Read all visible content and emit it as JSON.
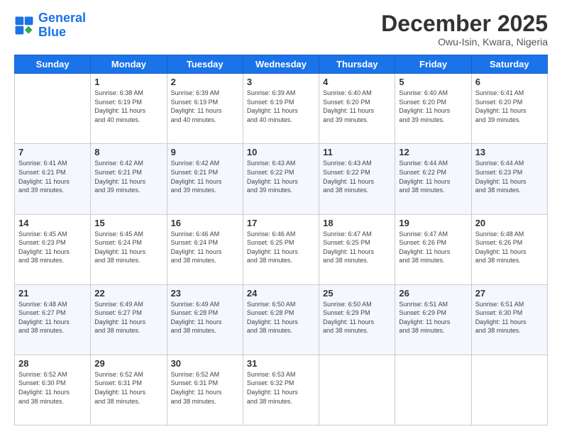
{
  "logo": {
    "line1": "General",
    "line2": "Blue"
  },
  "header": {
    "month": "December 2025",
    "location": "Owu-Isin, Kwara, Nigeria"
  },
  "weekdays": [
    "Sunday",
    "Monday",
    "Tuesday",
    "Wednesday",
    "Thursday",
    "Friday",
    "Saturday"
  ],
  "weeks": [
    [
      {
        "day": "",
        "sunrise": "",
        "sunset": "",
        "daylight": ""
      },
      {
        "day": "1",
        "sunrise": "6:38 AM",
        "sunset": "6:19 PM",
        "daylight": "11 hours and 40 minutes."
      },
      {
        "day": "2",
        "sunrise": "6:39 AM",
        "sunset": "6:19 PM",
        "daylight": "11 hours and 40 minutes."
      },
      {
        "day": "3",
        "sunrise": "6:39 AM",
        "sunset": "6:19 PM",
        "daylight": "11 hours and 40 minutes."
      },
      {
        "day": "4",
        "sunrise": "6:40 AM",
        "sunset": "6:20 PM",
        "daylight": "11 hours and 39 minutes."
      },
      {
        "day": "5",
        "sunrise": "6:40 AM",
        "sunset": "6:20 PM",
        "daylight": "11 hours and 39 minutes."
      },
      {
        "day": "6",
        "sunrise": "6:41 AM",
        "sunset": "6:20 PM",
        "daylight": "11 hours and 39 minutes."
      }
    ],
    [
      {
        "day": "7",
        "sunrise": "6:41 AM",
        "sunset": "6:21 PM",
        "daylight": "11 hours and 39 minutes."
      },
      {
        "day": "8",
        "sunrise": "6:42 AM",
        "sunset": "6:21 PM",
        "daylight": "11 hours and 39 minutes."
      },
      {
        "day": "9",
        "sunrise": "6:42 AM",
        "sunset": "6:21 PM",
        "daylight": "11 hours and 39 minutes."
      },
      {
        "day": "10",
        "sunrise": "6:43 AM",
        "sunset": "6:22 PM",
        "daylight": "11 hours and 39 minutes."
      },
      {
        "day": "11",
        "sunrise": "6:43 AM",
        "sunset": "6:22 PM",
        "daylight": "11 hours and 38 minutes."
      },
      {
        "day": "12",
        "sunrise": "6:44 AM",
        "sunset": "6:22 PM",
        "daylight": "11 hours and 38 minutes."
      },
      {
        "day": "13",
        "sunrise": "6:44 AM",
        "sunset": "6:23 PM",
        "daylight": "11 hours and 38 minutes."
      }
    ],
    [
      {
        "day": "14",
        "sunrise": "6:45 AM",
        "sunset": "6:23 PM",
        "daylight": "11 hours and 38 minutes."
      },
      {
        "day": "15",
        "sunrise": "6:45 AM",
        "sunset": "6:24 PM",
        "daylight": "11 hours and 38 minutes."
      },
      {
        "day": "16",
        "sunrise": "6:46 AM",
        "sunset": "6:24 PM",
        "daylight": "11 hours and 38 minutes."
      },
      {
        "day": "17",
        "sunrise": "6:46 AM",
        "sunset": "6:25 PM",
        "daylight": "11 hours and 38 minutes."
      },
      {
        "day": "18",
        "sunrise": "6:47 AM",
        "sunset": "6:25 PM",
        "daylight": "11 hours and 38 minutes."
      },
      {
        "day": "19",
        "sunrise": "6:47 AM",
        "sunset": "6:26 PM",
        "daylight": "11 hours and 38 minutes."
      },
      {
        "day": "20",
        "sunrise": "6:48 AM",
        "sunset": "6:26 PM",
        "daylight": "11 hours and 38 minutes."
      }
    ],
    [
      {
        "day": "21",
        "sunrise": "6:48 AM",
        "sunset": "6:27 PM",
        "daylight": "11 hours and 38 minutes."
      },
      {
        "day": "22",
        "sunrise": "6:49 AM",
        "sunset": "6:27 PM",
        "daylight": "11 hours and 38 minutes."
      },
      {
        "day": "23",
        "sunrise": "6:49 AM",
        "sunset": "6:28 PM",
        "daylight": "11 hours and 38 minutes."
      },
      {
        "day": "24",
        "sunrise": "6:50 AM",
        "sunset": "6:28 PM",
        "daylight": "11 hours and 38 minutes."
      },
      {
        "day": "25",
        "sunrise": "6:50 AM",
        "sunset": "6:29 PM",
        "daylight": "11 hours and 38 minutes."
      },
      {
        "day": "26",
        "sunrise": "6:51 AM",
        "sunset": "6:29 PM",
        "daylight": "11 hours and 38 minutes."
      },
      {
        "day": "27",
        "sunrise": "6:51 AM",
        "sunset": "6:30 PM",
        "daylight": "11 hours and 38 minutes."
      }
    ],
    [
      {
        "day": "28",
        "sunrise": "6:52 AM",
        "sunset": "6:30 PM",
        "daylight": "11 hours and 38 minutes."
      },
      {
        "day": "29",
        "sunrise": "6:52 AM",
        "sunset": "6:31 PM",
        "daylight": "11 hours and 38 minutes."
      },
      {
        "day": "30",
        "sunrise": "6:52 AM",
        "sunset": "6:31 PM",
        "daylight": "11 hours and 38 minutes."
      },
      {
        "day": "31",
        "sunrise": "6:53 AM",
        "sunset": "6:32 PM",
        "daylight": "11 hours and 38 minutes."
      },
      {
        "day": "",
        "sunrise": "",
        "sunset": "",
        "daylight": ""
      },
      {
        "day": "",
        "sunrise": "",
        "sunset": "",
        "daylight": ""
      },
      {
        "day": "",
        "sunrise": "",
        "sunset": "",
        "daylight": ""
      }
    ]
  ]
}
